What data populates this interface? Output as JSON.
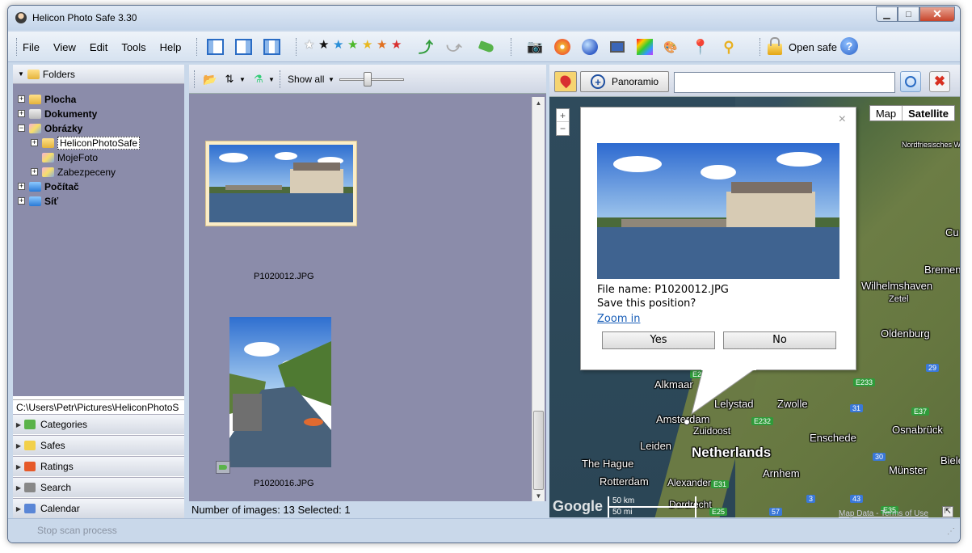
{
  "window": {
    "title": "Helicon Photo Safe 3.30",
    "minimize": "▁",
    "maximize": "□",
    "close": "✕"
  },
  "menu": [
    "File",
    "View",
    "Edit",
    "Tools",
    "Help"
  ],
  "toolbar": {
    "open_safe": "Open safe",
    "help_glyph": "?"
  },
  "folders": {
    "header": "Folders",
    "items": [
      {
        "label": "Plocha"
      },
      {
        "label": "Dokumenty"
      },
      {
        "label": "Obrázky"
      },
      {
        "label": "HeliconPhotoSafe"
      },
      {
        "label": "MojeFoto"
      },
      {
        "label": "Zabezpeceny"
      },
      {
        "label": "Počítač"
      },
      {
        "label": "Síť"
      }
    ],
    "path": "C:\\Users\\Petr\\Pictures\\HeliconPhotoS"
  },
  "accordion": [
    "Categories",
    "Safes",
    "Ratings",
    "Search",
    "Calendar"
  ],
  "browser": {
    "show_all": "Show all",
    "thumbnails": [
      {
        "filename": "P1020012.JPG"
      },
      {
        "filename": "P1020016.JPG"
      }
    ],
    "status": "Number of images: 13 Selected: 1"
  },
  "map": {
    "panoramio": "Panoramio",
    "search_value": "",
    "type_map": "Map",
    "type_satellite": "Satellite",
    "zoom_in": "+",
    "zoom_out": "−",
    "labels": [
      "Bremen",
      "Wilhelmshaven",
      "Zetel",
      "Oldenburg",
      "Alkmaar",
      "Lelystad",
      "Zwolle",
      "Amsterdam",
      "Zuidoost",
      "Leiden",
      "Netherlands",
      "The Hague",
      "Enschede",
      "Osnabrück",
      "Rotterdam",
      "Arnhem",
      "Münster",
      "Alexander",
      "Dordrecht",
      "Nordfriesisches Wattenmeer",
      "Bielefeld",
      "Cu"
    ],
    "roads": [
      "29",
      "E233",
      "E22",
      "31",
      "E37",
      "E232",
      "30",
      "E31",
      "3",
      "E25",
      "57",
      "43",
      "E35"
    ],
    "scale_km": "50 km",
    "scale_mi": "50 mi",
    "attribution": "Map Data - Terms of Use",
    "google": "Google",
    "popup": {
      "close": "×",
      "file_name": "File name: P1020012.JPG",
      "question": "Save this position?",
      "zoom_in": "Zoom in",
      "yes": "Yes",
      "no": "No"
    }
  },
  "status_bar": {
    "stop_scan": "Stop scan process"
  }
}
